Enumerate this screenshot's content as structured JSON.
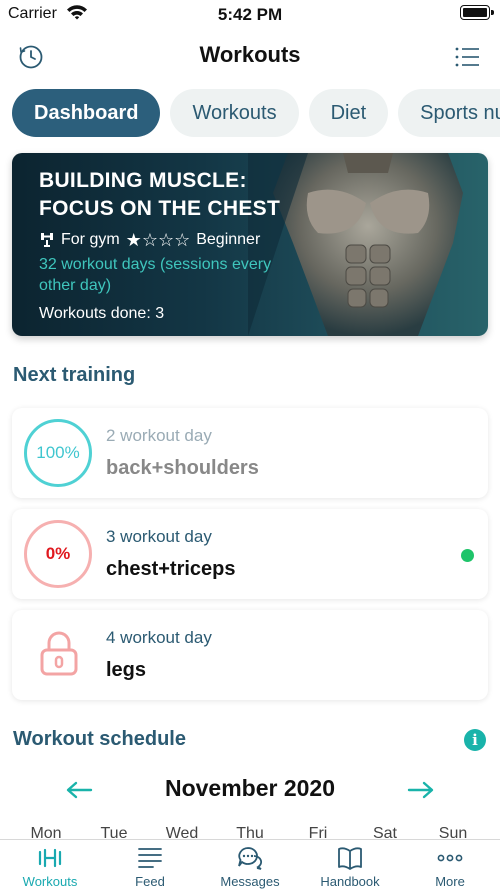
{
  "status_bar": {
    "carrier": "Carrier",
    "time": "5:42 PM"
  },
  "nav": {
    "title": "Workouts",
    "left_icon": "history-icon",
    "right_icon": "list-icon"
  },
  "tabs": [
    {
      "label": "Dashboard",
      "active": true
    },
    {
      "label": "Workouts",
      "active": false
    },
    {
      "label": "Diet",
      "active": false
    },
    {
      "label": "Sports nutrition",
      "active": false
    }
  ],
  "program": {
    "title_line1": "BUILDING MUSCLE:",
    "title_line2": "FOCUS ON THE CHEST",
    "location": "For gym",
    "level": "Beginner",
    "rating": 1,
    "rating_max": 4,
    "days_text": "32 workout days (sessions every other day)",
    "done_label": "Workouts done:",
    "done_count": "3"
  },
  "next_training": {
    "title": "Next training",
    "items": [
      {
        "day": "2 workout day",
        "name": "back+shoulders",
        "progress": "100%",
        "state": "completed"
      },
      {
        "day": "3 workout day",
        "name": "chest+triceps",
        "progress": "0%",
        "state": "current"
      },
      {
        "day": "4 workout day",
        "name": "legs",
        "progress": "",
        "state": "locked"
      }
    ]
  },
  "schedule": {
    "title": "Workout schedule",
    "month": "November 2020",
    "weekdays": [
      "Mon",
      "Tue",
      "Wed",
      "Thu",
      "Fri",
      "Sat",
      "Sun"
    ]
  },
  "tabbar": [
    {
      "label": "Workouts",
      "icon": "dumbbell-icon",
      "active": true
    },
    {
      "label": "Feed",
      "icon": "feed-icon",
      "active": false
    },
    {
      "label": "Messages",
      "icon": "messages-icon",
      "active": false
    },
    {
      "label": "Handbook",
      "icon": "book-icon",
      "active": false
    },
    {
      "label": "More",
      "icon": "more-icon",
      "active": false
    }
  ],
  "colors": {
    "primary": "#2c5f7c",
    "accent": "#19b3aa",
    "completed_ring": "#4fd1d4",
    "pending_ring": "#f6b0b0",
    "current_dot": "#1fc46a"
  }
}
